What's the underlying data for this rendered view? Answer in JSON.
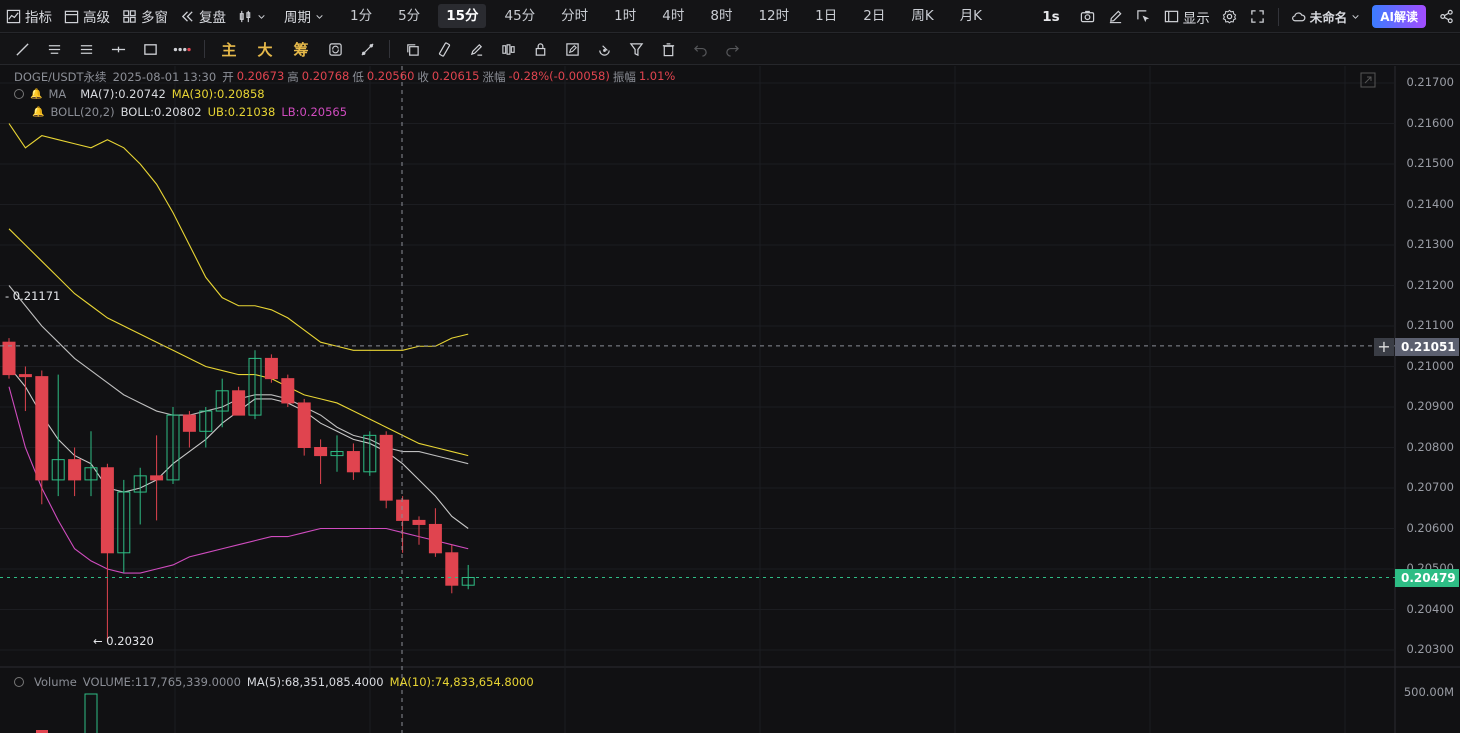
{
  "topbar": {
    "indicators": "指标",
    "advanced": "高级",
    "multiwindow": "多窗",
    "replay": "复盘",
    "period_menu": "周期",
    "periods": [
      "1分",
      "5分",
      "15分",
      "45分",
      "分时",
      "1时",
      "4时",
      "8时",
      "12时",
      "1日",
      "2日",
      "周K",
      "月K"
    ],
    "active_period": "15分",
    "refresh": "1s",
    "display": "显示",
    "layout_name": "未命名",
    "ai": "AI解读"
  },
  "toolbar": {
    "main": "主",
    "big": "大",
    "chips": "筹"
  },
  "legend": {
    "symbol": "DOGE/USDT永续",
    "time": "2025-08-01 13:30",
    "open_label": "开",
    "open": "0.20673",
    "high_label": "高",
    "high": "0.20768",
    "low_label": "低",
    "low": "0.20560",
    "close_label": "收",
    "close": "0.20615",
    "change_label": "涨幅",
    "change": "-0.28%(-0.00058)",
    "amp_label": "振幅",
    "amp": "1.01%",
    "ma_name": "MA",
    "ma7": "MA(7):0.20742",
    "ma30": "MA(30):0.20858",
    "boll_name": "BOLL(20,2)",
    "boll": "BOLL:0.20802",
    "ub": "UB:0.21038",
    "lb": "LB:0.20565",
    "vol_name": "Volume",
    "vol": "VOLUME:117,765,339.0000",
    "vol_ma5": "MA(5):68,351,085.4000",
    "vol_ma10": "MA(10):74,833,654.8000"
  },
  "axis": {
    "prices": [
      "0.21700",
      "0.21600",
      "0.21500",
      "0.21400",
      "0.21300",
      "0.21200",
      "0.21100",
      "0.21000",
      "0.20900",
      "0.20800",
      "0.20700",
      "0.20600",
      "0.20500",
      "0.20400",
      "0.20300"
    ],
    "volume_label": "500.00M",
    "crosshair_price": "0.21051",
    "last_price": "0.20479"
  },
  "annotations": {
    "high_mark": "- 0.21171",
    "low_mark": "← 0.20320"
  },
  "colors": {
    "up": "#2ebd85",
    "down": "#e0444f",
    "ma7": "#c8c8c8",
    "ma30": "#e8d534",
    "boll": "#bfbfbf",
    "ub": "#e8d534",
    "lb": "#d04cbf"
  },
  "candles": [
    {
      "o": 0.2106,
      "h": 0.2107,
      "l": 0.2097,
      "c": 0.2098
    },
    {
      "o": 0.2098,
      "h": 0.21,
      "l": 0.2089,
      "c": 0.20975
    },
    {
      "o": 0.20975,
      "h": 0.2099,
      "l": 0.2066,
      "c": 0.2072
    },
    {
      "o": 0.2072,
      "h": 0.2098,
      "l": 0.2068,
      "c": 0.2077
    },
    {
      "o": 0.2077,
      "h": 0.208,
      "l": 0.2068,
      "c": 0.2072
    },
    {
      "o": 0.2072,
      "h": 0.2084,
      "l": 0.2068,
      "c": 0.2075
    },
    {
      "o": 0.2075,
      "h": 0.2076,
      "l": 0.2032,
      "c": 0.2054
    },
    {
      "o": 0.2054,
      "h": 0.2072,
      "l": 0.2049,
      "c": 0.2069
    },
    {
      "o": 0.2069,
      "h": 0.2075,
      "l": 0.2061,
      "c": 0.2073
    },
    {
      "o": 0.2073,
      "h": 0.2083,
      "l": 0.2062,
      "c": 0.2072
    },
    {
      "o": 0.2072,
      "h": 0.209,
      "l": 0.2071,
      "c": 0.2088
    },
    {
      "o": 0.2088,
      "h": 0.2089,
      "l": 0.208,
      "c": 0.2084
    },
    {
      "o": 0.2084,
      "h": 0.209,
      "l": 0.208,
      "c": 0.2089
    },
    {
      "o": 0.2089,
      "h": 0.2097,
      "l": 0.2085,
      "c": 0.2094
    },
    {
      "o": 0.2094,
      "h": 0.2095,
      "l": 0.2088,
      "c": 0.2088
    },
    {
      "o": 0.2088,
      "h": 0.2104,
      "l": 0.2087,
      "c": 0.2102
    },
    {
      "o": 0.2102,
      "h": 0.2103,
      "l": 0.2096,
      "c": 0.2097
    },
    {
      "o": 0.2097,
      "h": 0.2098,
      "l": 0.209,
      "c": 0.2091
    },
    {
      "o": 0.2091,
      "h": 0.2092,
      "l": 0.2078,
      "c": 0.208
    },
    {
      "o": 0.208,
      "h": 0.2082,
      "l": 0.2071,
      "c": 0.2078
    },
    {
      "o": 0.2078,
      "h": 0.2083,
      "l": 0.2074,
      "c": 0.2079
    },
    {
      "o": 0.2079,
      "h": 0.2081,
      "l": 0.2072,
      "c": 0.2074
    },
    {
      "o": 0.2074,
      "h": 0.2084,
      "l": 0.2073,
      "c": 0.2083
    },
    {
      "o": 0.2083,
      "h": 0.2084,
      "l": 0.2065,
      "c": 0.2067
    },
    {
      "o": 0.2067,
      "h": 0.2068,
      "l": 0.2054,
      "c": 0.2062
    },
    {
      "o": 0.2062,
      "h": 0.2063,
      "l": 0.2056,
      "c": 0.2061
    },
    {
      "o": 0.2061,
      "h": 0.2065,
      "l": 0.2053,
      "c": 0.2054
    },
    {
      "o": 0.2054,
      "h": 0.2056,
      "l": 0.2044,
      "c": 0.2046
    },
    {
      "o": 0.2046,
      "h": 0.2051,
      "l": 0.2045,
      "c": 0.20479
    }
  ],
  "lines": {
    "ma7": [
      0.21,
      0.2095,
      0.2088,
      0.2082,
      0.2078,
      0.2076,
      0.207,
      0.2069,
      0.207,
      0.2072,
      0.2076,
      0.2079,
      0.2082,
      0.2086,
      0.2089,
      0.2092,
      0.2092,
      0.2091,
      0.2089,
      0.2086,
      0.2084,
      0.2082,
      0.2081,
      0.2079,
      0.2076,
      0.2072,
      0.2068,
      0.2063,
      0.206
    ],
    "ma30": [
      0.2134,
      0.213,
      0.2126,
      0.2122,
      0.2118,
      0.2115,
      0.2112,
      0.211,
      0.2108,
      0.2106,
      0.2104,
      0.2102,
      0.21,
      0.2099,
      0.2098,
      0.2098,
      0.2097,
      0.2095,
      0.2093,
      0.2092,
      0.2091,
      0.2089,
      0.2087,
      0.2085,
      0.2083,
      0.2081,
      0.208,
      0.2079,
      0.2078
    ],
    "ub": [
      0.216,
      0.2154,
      0.2157,
      0.2156,
      0.2155,
      0.2154,
      0.2156,
      0.2154,
      0.215,
      0.2145,
      0.2138,
      0.213,
      0.2122,
      0.2117,
      0.2115,
      0.2115,
      0.2114,
      0.2112,
      0.2109,
      0.2106,
      0.2105,
      0.2104,
      0.2104,
      0.2104,
      0.2104,
      0.2105,
      0.2105,
      0.2107,
      0.2108
    ],
    "boll": [
      0.212,
      0.2115,
      0.211,
      0.2106,
      0.2102,
      0.2099,
      0.2096,
      0.2093,
      0.2091,
      0.2089,
      0.2088,
      0.2088,
      0.2089,
      0.209,
      0.2092,
      0.2093,
      0.2093,
      0.2092,
      0.209,
      0.2088,
      0.2085,
      0.2083,
      0.2082,
      0.208,
      0.2079,
      0.2079,
      0.2078,
      0.2077,
      0.2076
    ],
    "lb": [
      0.2095,
      0.208,
      0.207,
      0.2062,
      0.2055,
      0.2052,
      0.205,
      0.2049,
      0.2049,
      0.205,
      0.2051,
      0.2053,
      0.2054,
      0.2055,
      0.2056,
      0.2057,
      0.2058,
      0.2058,
      0.2059,
      0.206,
      0.206,
      0.206,
      0.206,
      0.206,
      0.2059,
      0.2058,
      0.2057,
      0.2056,
      0.2055
    ]
  }
}
